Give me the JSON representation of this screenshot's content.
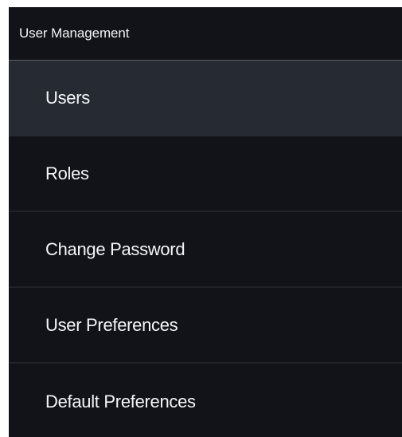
{
  "panel": {
    "title": "User Management"
  },
  "menu": {
    "active_index": 0,
    "items": [
      {
        "label": "Users"
      },
      {
        "label": "Roles"
      },
      {
        "label": "Change Password"
      },
      {
        "label": "User Preferences"
      },
      {
        "label": "Default Preferences"
      }
    ]
  },
  "colors": {
    "panel_background": "#111318",
    "active_item_background": "#252a33",
    "text": "#f4f5f7",
    "divider": "#20232a"
  }
}
